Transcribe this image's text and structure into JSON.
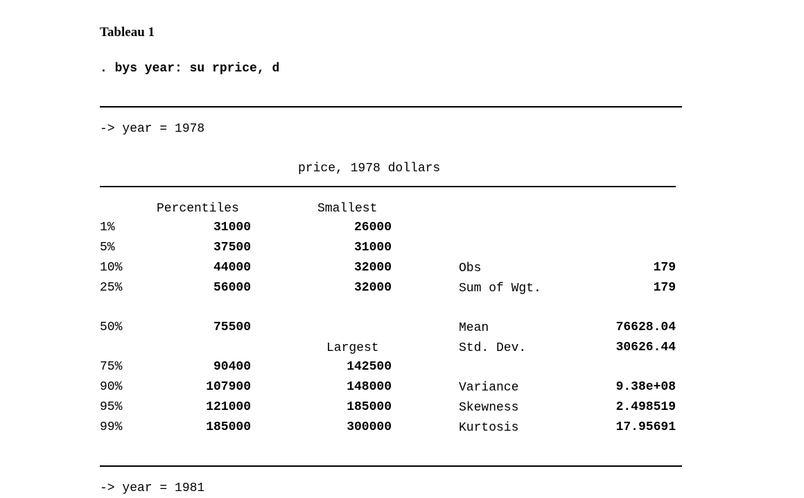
{
  "title": "Tableau 1",
  "command": ". bys year: su rprice, d",
  "group1_header": "-> year = 1978",
  "variable_label": "price, 1978 dollars",
  "columns": {
    "percentiles": "Percentiles",
    "smallest": "Smallest",
    "largest": "Largest"
  },
  "rows": [
    {
      "pct": "1%",
      "value": "31000",
      "extreme": "26000"
    },
    {
      "pct": "5%",
      "value": "37500",
      "extreme": "31000"
    },
    {
      "pct": "10%",
      "value": "44000",
      "extreme": "32000"
    },
    {
      "pct": "25%",
      "value": "56000",
      "extreme": "32000"
    },
    {
      "pct": "50%",
      "value": "75500",
      "extreme": ""
    },
    {
      "pct": "75%",
      "value": "90400",
      "extreme": "142500"
    },
    {
      "pct": "90%",
      "value": "107900",
      "extreme": "148000"
    },
    {
      "pct": "95%",
      "value": "121000",
      "extreme": "185000"
    },
    {
      "pct": "99%",
      "value": "185000",
      "extreme": "300000"
    }
  ],
  "stats": [
    {
      "label": "Obs",
      "value": "179"
    },
    {
      "label": "Sum of Wgt.",
      "value": "179"
    },
    {
      "label": "Mean",
      "value": "76628.04"
    },
    {
      "label": "Std. Dev.",
      "value": "30626.44"
    },
    {
      "label": "Variance",
      "value": "9.38e+08"
    },
    {
      "label": "Skewness",
      "value": "2.498519"
    },
    {
      "label": "Kurtosis",
      "value": "17.95691"
    }
  ],
  "group2_header": "-> year = 1981"
}
